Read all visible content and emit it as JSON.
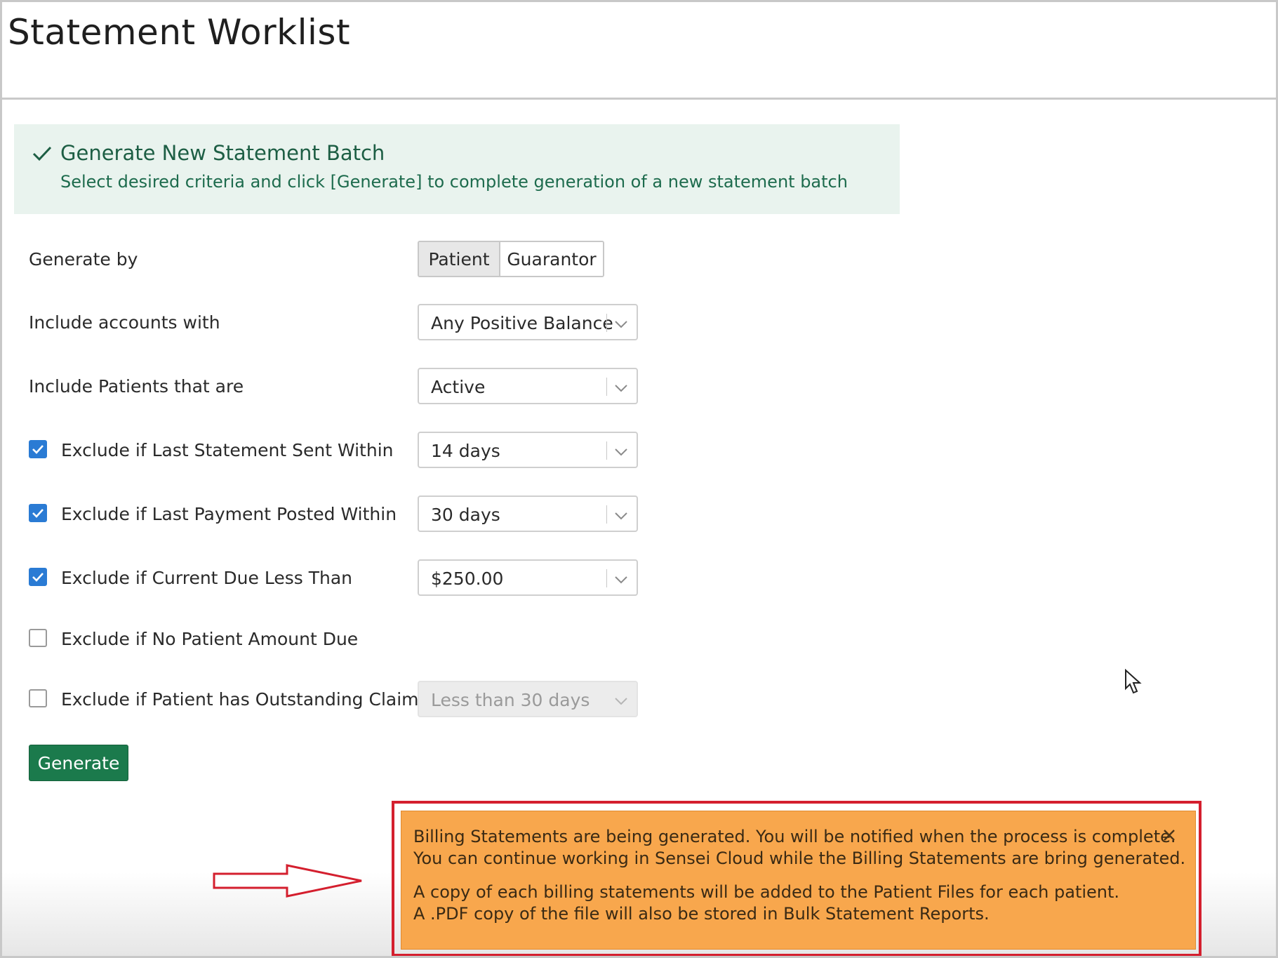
{
  "page": {
    "title": "Statement Worklist"
  },
  "banner": {
    "title": "Generate New Statement Batch",
    "subtitle": "Select desired criteria and click [Generate] to complete generation of a new statement batch",
    "icon": "checkmark-icon"
  },
  "form": {
    "generate_by": {
      "label": "Generate by",
      "options": [
        "Patient",
        "Guarantor"
      ],
      "selected": "Patient"
    },
    "include_accounts": {
      "label": "Include accounts with",
      "value": "Any Positive Balance"
    },
    "include_patients": {
      "label": "Include Patients that are",
      "value": "Active"
    },
    "exclude_last_statement": {
      "label": "Exclude if Last Statement Sent Within",
      "checked": true,
      "value": "14 days"
    },
    "exclude_last_payment": {
      "label": "Exclude if Last Payment Posted Within",
      "checked": true,
      "value": "30 days"
    },
    "exclude_current_due": {
      "label": "Exclude if Current Due Less Than",
      "checked": true,
      "value": "$250.00"
    },
    "exclude_no_amount": {
      "label": "Exclude if No Patient Amount Due",
      "checked": false
    },
    "exclude_outstanding_claims": {
      "label": "Exclude if Patient has Outstanding Claims",
      "checked": false,
      "value": "Less than 30 days",
      "disabled": true
    },
    "generate_button": "Generate"
  },
  "toast": {
    "line1": "Billing Statements are being generated. You will be notified when the process is complete.",
    "line2": "You can continue working in Sensei Cloud while the Billing Statements are bring generated.",
    "line3": "A copy of each billing statements will be added to the Patient Files for each patient.",
    "line4": "A .PDF copy of the file will also be stored in Bulk Statement Reports.",
    "background_color": "#f8a74d"
  },
  "colors": {
    "accent_green": "#1b7a4c",
    "checkbox_blue": "#2a7bd4",
    "highlight_red": "#d41f2e",
    "banner_bg": "#e9f3ee"
  }
}
